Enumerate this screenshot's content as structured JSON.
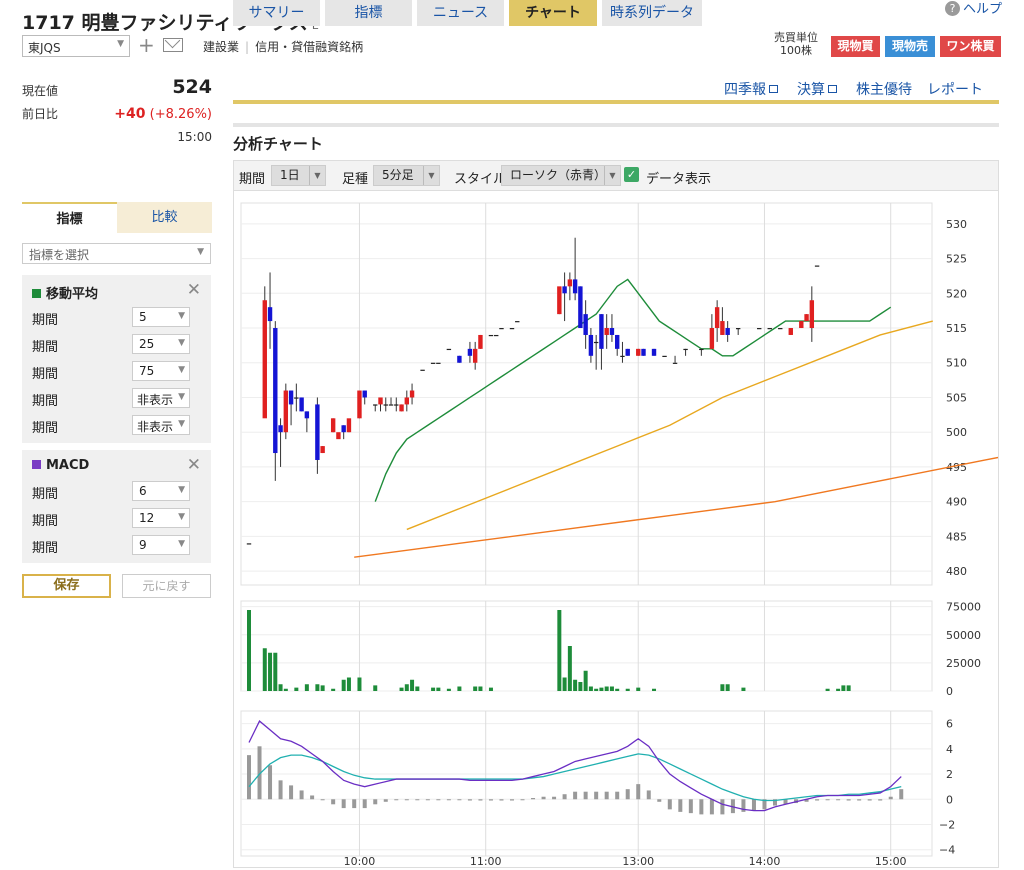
{
  "header": {
    "code": "1717",
    "name": "明豊ファシリティワークス",
    "market_mark": "E",
    "help": "ヘルプ",
    "market": "東JQS",
    "industry": "建設業",
    "tag": "信用・貸借融資銘柄",
    "unit_label": "売買単位",
    "unit_value": "100株",
    "btn_buy": "現物買",
    "btn_sell": "現物売",
    "btn_one": "ワン株買",
    "btn_buy_color": "#e04848",
    "btn_sell_color": "#3a8fd6",
    "btn_one_color": "#e04848"
  },
  "price": {
    "current_label": "現在値",
    "current": "524",
    "prev_label": "前日比",
    "change": "+40",
    "change_pct": "(+8.26%)",
    "time": "15:00"
  },
  "tabs": [
    "サマリー",
    "指標",
    "ニュース",
    "チャート",
    "時系列データ"
  ],
  "active_tab": "チャート",
  "links": [
    "四季報",
    "決算",
    "株主優待",
    "レポート"
  ],
  "section_title": "分析チャート",
  "toolbar": {
    "period_label": "期間",
    "period_value": "1日",
    "foot_label": "足種",
    "foot_value": "5分足",
    "style_label": "スタイル",
    "style_value": "ローソク（赤青）",
    "data_label": "データ表示"
  },
  "left_panel": {
    "tab_indicator": "指標",
    "tab_compare": "比較",
    "select_placeholder": "指標を選択",
    "ma_title": "移動平均",
    "ma_color": "#1e8c3a",
    "ma_rows": [
      {
        "label": "期間",
        "value": "5"
      },
      {
        "label": "期間",
        "value": "25"
      },
      {
        "label": "期間",
        "value": "75"
      },
      {
        "label": "期間",
        "value": "非表示"
      },
      {
        "label": "期間",
        "value": "非表示"
      }
    ],
    "macd_title": "MACD",
    "macd_color": "#7a3cc4",
    "macd_rows": [
      {
        "label": "期間",
        "value": "6"
      },
      {
        "label": "期間",
        "value": "12"
      },
      {
        "label": "期間",
        "value": "9"
      }
    ],
    "save": "保存",
    "reset": "元に戻す"
  },
  "chart_data": {
    "type": "candlestick",
    "price_axis": {
      "ylim": [
        478,
        533
      ],
      "ticks": [
        530,
        525,
        520,
        515,
        510,
        505,
        500,
        495,
        490,
        485,
        480
      ]
    },
    "volume_axis": {
      "ylim": [
        0,
        80000
      ],
      "ticks": [
        "75000",
        "50000",
        "25000",
        "0"
      ]
    },
    "macd_axis": {
      "ylim": [
        -4.5,
        7
      ],
      "ticks": [
        6,
        4,
        2,
        0,
        -2,
        -4
      ]
    },
    "time_labels": [
      "10:00",
      "11:00",
      "13:00",
      "14:00",
      "15:00"
    ],
    "time_label_index": [
      21,
      45,
      74,
      98,
      122
    ],
    "colors": {
      "up": "#e02020",
      "down": "#1414d4",
      "ma5": "#1e8c3a",
      "ma25": "#e8a820",
      "ma75": "#f07820",
      "volume": "#1e8c3a",
      "macd": "#6a2ec4",
      "signal": "#20b0b0",
      "hist": "#999999"
    },
    "candles": [
      [
        484,
        484,
        484,
        484
      ],
      [
        null
      ],
      [
        null
      ],
      [
        502,
        521,
        509,
        519
      ],
      [
        518,
        523,
        512,
        516
      ],
      [
        515,
        516,
        493,
        497
      ],
      [
        501,
        502,
        495,
        500
      ],
      [
        500,
        507,
        499,
        506
      ],
      [
        506,
        506,
        501,
        504
      ],
      [
        505,
        507,
        503,
        505
      ],
      [
        505,
        505,
        503,
        503
      ],
      [
        503,
        503,
        500,
        502
      ],
      [
        null
      ],
      [
        504,
        505,
        494,
        496
      ],
      [
        497,
        498,
        497,
        498
      ],
      [
        null
      ],
      [
        500,
        502,
        500,
        502
      ],
      [
        499,
        499,
        499,
        500
      ],
      [
        501,
        501,
        499,
        500
      ],
      [
        500,
        501,
        500,
        502
      ],
      [
        null
      ],
      [
        502,
        506,
        502,
        506
      ],
      [
        506,
        506,
        504,
        505
      ],
      [
        null
      ],
      [
        504,
        504,
        503,
        504
      ],
      [
        504,
        505,
        503,
        505
      ],
      [
        504,
        505,
        503,
        504
      ],
      [
        504,
        505,
        504,
        504
      ],
      [
        504,
        505,
        503,
        504
      ],
      [
        503,
        504,
        503,
        504
      ],
      [
        504,
        506,
        503,
        505
      ],
      [
        505,
        507,
        504,
        506
      ],
      [
        null
      ],
      [
        509,
        509,
        509,
        509
      ],
      [
        null
      ],
      [
        510,
        510,
        510,
        510
      ],
      [
        510,
        510,
        510,
        510
      ],
      [
        null
      ],
      [
        512,
        512,
        512,
        512
      ],
      [
        null
      ],
      [
        511,
        511,
        510,
        510
      ],
      [
        null
      ],
      [
        512,
        513,
        510,
        511
      ],
      [
        510,
        513,
        509,
        512
      ],
      [
        512,
        514,
        512,
        514
      ],
      [
        null
      ],
      [
        514,
        514,
        514,
        514
      ],
      [
        514,
        514,
        514,
        514
      ],
      [
        515,
        515,
        515,
        515
      ],
      [
        null
      ],
      [
        515,
        515,
        515,
        515
      ],
      [
        516,
        516,
        516,
        516
      ],
      [
        null
      ],
      [
        null
      ],
      [
        null
      ],
      [
        null
      ],
      [
        null
      ],
      [
        null
      ],
      [
        null
      ],
      [
        517,
        520,
        517,
        521
      ],
      [
        521,
        523,
        516,
        520
      ],
      [
        521,
        523,
        519,
        522
      ],
      [
        522,
        528,
        519,
        520
      ],
      [
        521,
        521,
        515,
        515
      ],
      [
        517,
        519,
        512,
        514
      ],
      [
        514,
        515,
        510,
        511
      ],
      [
        513,
        514,
        509,
        513
      ],
      [
        517,
        517,
        509,
        512
      ],
      [
        514,
        517,
        512,
        515
      ],
      [
        515,
        517,
        513,
        514
      ],
      [
        514,
        514,
        511,
        512
      ],
      [
        511,
        513,
        510,
        511
      ],
      [
        512,
        512,
        511,
        511
      ],
      [
        null
      ],
      [
        511,
        512,
        511,
        512
      ],
      [
        512,
        512,
        511,
        511
      ],
      [
        null
      ],
      [
        512,
        512,
        511,
        511
      ],
      [
        null
      ],
      [
        511,
        511,
        511,
        511
      ],
      [
        null
      ],
      [
        510,
        511,
        510,
        510
      ],
      [
        null
      ],
      [
        512,
        512,
        511,
        512
      ],
      [
        null
      ],
      [
        null
      ],
      [
        512,
        512,
        511,
        512
      ],
      [
        null
      ],
      [
        512,
        517,
        512,
        515
      ],
      [
        515,
        519,
        513,
        518
      ],
      [
        514,
        518,
        514,
        516
      ],
      [
        515,
        516,
        513,
        514
      ],
      [
        null
      ],
      [
        515,
        515,
        514,
        515
      ],
      [
        null
      ],
      [
        null
      ],
      [
        null
      ],
      [
        515,
        515,
        515,
        515
      ],
      [
        null
      ],
      [
        515,
        515,
        515,
        515
      ],
      [
        null
      ],
      [
        515,
        515,
        515,
        515
      ],
      [
        null
      ],
      [
        514,
        515,
        514,
        515
      ],
      [
        null
      ],
      [
        515,
        516,
        515,
        516
      ],
      [
        516,
        517,
        516,
        517
      ],
      [
        515,
        521,
        513,
        519
      ],
      [
        524,
        524,
        524,
        524
      ]
    ],
    "ma5": [
      [
        24,
        490
      ],
      [
        26,
        494
      ],
      [
        28,
        497
      ],
      [
        30,
        499
      ],
      [
        32,
        500
      ],
      [
        34,
        501
      ],
      [
        36,
        502
      ],
      [
        38,
        503
      ],
      [
        40,
        504
      ],
      [
        42,
        505
      ],
      [
        44,
        506
      ],
      [
        46,
        507
      ],
      [
        48,
        508
      ],
      [
        50,
        509
      ],
      [
        52,
        510
      ],
      [
        54,
        511
      ],
      [
        56,
        512
      ],
      [
        58,
        513
      ],
      [
        60,
        514
      ],
      [
        62,
        515
      ],
      [
        64,
        516
      ],
      [
        66,
        517
      ],
      [
        68,
        519
      ],
      [
        70,
        521
      ],
      [
        72,
        522
      ],
      [
        74,
        520
      ],
      [
        76,
        518
      ],
      [
        78,
        516
      ],
      [
        80,
        515
      ],
      [
        82,
        514
      ],
      [
        84,
        513
      ],
      [
        86,
        512
      ],
      [
        88,
        512
      ],
      [
        90,
        511
      ],
      [
        92,
        511
      ],
      [
        94,
        512
      ],
      [
        96,
        513
      ],
      [
        98,
        514
      ],
      [
        100,
        515
      ],
      [
        102,
        516
      ],
      [
        104,
        516
      ],
      [
        106,
        516
      ],
      [
        108,
        516
      ],
      [
        110,
        516
      ],
      [
        112,
        516
      ],
      [
        114,
        516
      ],
      [
        116,
        516
      ],
      [
        118,
        516
      ],
      [
        120,
        517
      ],
      [
        122,
        518
      ]
    ],
    "ma25": [
      [
        30,
        486
      ],
      [
        40,
        489
      ],
      [
        50,
        492
      ],
      [
        60,
        495
      ],
      [
        70,
        498
      ],
      [
        80,
        501
      ],
      [
        90,
        505
      ],
      [
        100,
        508
      ],
      [
        110,
        511
      ],
      [
        120,
        514
      ],
      [
        130,
        516
      ]
    ],
    "ma75": [
      [
        20,
        482
      ],
      [
        40,
        484
      ],
      [
        60,
        486
      ],
      [
        80,
        488
      ],
      [
        100,
        490
      ],
      [
        120,
        493
      ],
      [
        140,
        496
      ],
      [
        160,
        499
      ],
      [
        180,
        503
      ],
      [
        200,
        506
      ]
    ],
    "volume": [
      72000,
      0,
      0,
      38000,
      34000,
      34000,
      6000,
      2000,
      0,
      3000,
      0,
      6000,
      0,
      6000,
      5000,
      0,
      2000,
      0,
      10000,
      12000,
      0,
      12000,
      0,
      0,
      5000,
      0,
      0,
      0,
      0,
      3000,
      6000,
      10000,
      4000,
      0,
      0,
      3000,
      3000,
      0,
      2000,
      0,
      4000,
      0,
      0,
      4000,
      4000,
      0,
      3000,
      0,
      0,
      0,
      0,
      0,
      0,
      0,
      0,
      0,
      0,
      0,
      0,
      72000,
      12000,
      40000,
      10000,
      8000,
      18000,
      4000,
      2000,
      3000,
      4000,
      4000,
      2000,
      0,
      2000,
      0,
      3000,
      0,
      0,
      2000,
      0,
      0,
      0,
      0,
      0,
      0,
      0,
      0,
      0,
      0,
      0,
      0,
      6000,
      6000,
      0,
      0,
      3000,
      0,
      0,
      0,
      0,
      0,
      0,
      0,
      0,
      0,
      0,
      0,
      0,
      0,
      0,
      0,
      2000,
      0,
      2000,
      5000,
      5000
    ],
    "macd": [
      4.5,
      6.2,
      5.5,
      4.8,
      4.6,
      4.2,
      3.6,
      3.0,
      2.2,
      1.5,
      1.2,
      1.0,
      1.2,
      1.4,
      1.6,
      1.6,
      1.6,
      1.6,
      1.6,
      1.6,
      1.6,
      1.5,
      1.5,
      1.5,
      1.5,
      1.5,
      1.6,
      1.8,
      2.0,
      2.2,
      2.6,
      3.0,
      3.2,
      3.4,
      3.6,
      3.8,
      4.2,
      4.8,
      4.2,
      3.0,
      2.0,
      1.4,
      0.9,
      0.4,
      0.0,
      -0.4,
      -0.6,
      -0.8,
      -0.9,
      -0.9,
      -0.6,
      -0.4,
      -0.2,
      0.0,
      0.2,
      0.3,
      0.3,
      0.3,
      0.3,
      0.4,
      0.5,
      1.0,
      1.8
    ],
    "signal": [
      1.0,
      2.0,
      2.8,
      3.3,
      3.5,
      3.5,
      3.3,
      3.0,
      2.6,
      2.2,
      1.9,
      1.7,
      1.6,
      1.6,
      1.6,
      1.6,
      1.6,
      1.6,
      1.6,
      1.6,
      1.6,
      1.6,
      1.6,
      1.6,
      1.6,
      1.6,
      1.6,
      1.7,
      1.8,
      2.0,
      2.2,
      2.4,
      2.6,
      2.8,
      3.0,
      3.2,
      3.4,
      3.6,
      3.5,
      3.2,
      2.8,
      2.4,
      2.0,
      1.6,
      1.2,
      0.8,
      0.5,
      0.2,
      0.0,
      -0.1,
      -0.1,
      0.0,
      0.1,
      0.2,
      0.3,
      0.3,
      0.3,
      0.4,
      0.4,
      0.5,
      0.6,
      0.8,
      1.0
    ],
    "hist": [
      3.5,
      4.2,
      2.7,
      1.5,
      1.1,
      0.7,
      0.3,
      0.0,
      -0.4,
      -0.7,
      -0.7,
      -0.7,
      -0.4,
      -0.2,
      0.0,
      0.0,
      0.0,
      0.0,
      0.0,
      0.0,
      0.0,
      -0.1,
      -0.1,
      -0.1,
      -0.1,
      -0.1,
      0.0,
      0.1,
      0.2,
      0.2,
      0.4,
      0.6,
      0.6,
      0.6,
      0.6,
      0.6,
      0.8,
      1.2,
      0.7,
      -0.2,
      -0.8,
      -1.0,
      -1.1,
      -1.2,
      -1.2,
      -1.2,
      -1.1,
      -1.0,
      -0.9,
      -0.8,
      -0.5,
      -0.4,
      -0.3,
      -0.2,
      -0.1,
      0.0,
      0.0,
      -0.1,
      -0.1,
      -0.1,
      -0.1,
      0.2,
      0.8
    ]
  }
}
